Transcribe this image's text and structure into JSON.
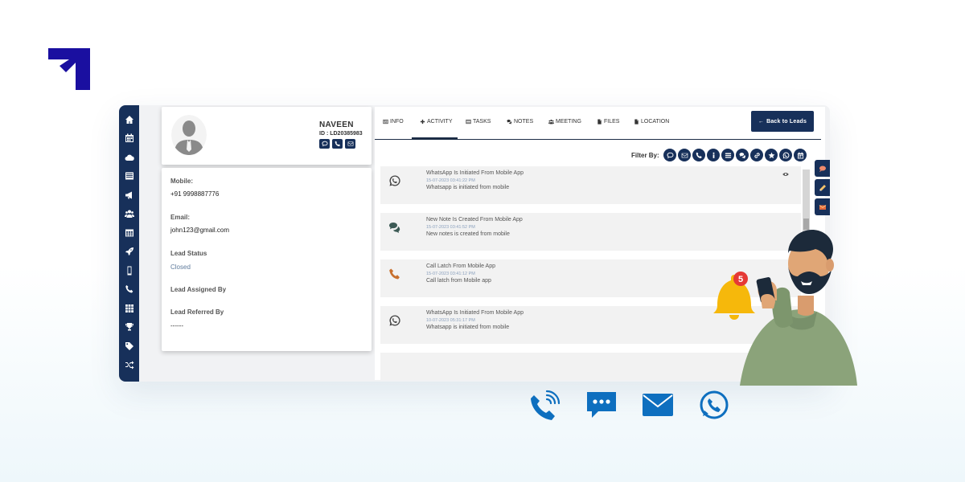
{
  "lead": {
    "name": "NAVEEN",
    "id": "ID : LD20385983"
  },
  "details": [
    {
      "label": "Mobile:",
      "value": "+91 9998887776"
    },
    {
      "label": "Email:",
      "value": "john123@gmail.com"
    },
    {
      "label": "Lead Status",
      "value": "Closed"
    },
    {
      "label": "Lead Assigned By",
      "value": ""
    },
    {
      "label": "Lead Referred By",
      "value": "------"
    }
  ],
  "tabs": [
    {
      "label": "INFO",
      "icon": "info-card-icon"
    },
    {
      "label": "ACTIVITY",
      "icon": "plus-icon"
    },
    {
      "label": "TASKS",
      "icon": "tasks-icon"
    },
    {
      "label": "NOTES",
      "icon": "comments-icon"
    },
    {
      "label": "MEETING",
      "icon": "users-icon"
    },
    {
      "label": "FILES",
      "icon": "file-icon"
    },
    {
      "label": "LOCATION",
      "icon": "file-icon"
    }
  ],
  "active_tab": "ACTIVITY",
  "back_button": "Back to Leads",
  "filter_label": "Filter By:",
  "filter_icons": [
    "chat-icon",
    "email-icon",
    "phone-icon",
    "info-icon",
    "list-icon",
    "comments-icon",
    "link-icon",
    "star-icon",
    "whatsapp-icon",
    "calendar-icon"
  ],
  "activities": [
    {
      "icon": "whatsapp-icon",
      "title": "WhatsApp Is Initiated From Mobile App",
      "time": "15-07-2023 03:41:22 PM",
      "desc": "Whatsapp is initiated from mobile"
    },
    {
      "icon": "comments-icon",
      "title": "New Note Is Created From Mobile App",
      "time": "15-07-2023 03:41:52 PM",
      "desc": "New notes is created from mobile"
    },
    {
      "icon": "phone-icon",
      "title": "Call Latch From Mobile App",
      "time": "15-07-2023 03:41:12 PM",
      "desc": "Call latch from Mobile app"
    },
    {
      "icon": "whatsapp-icon",
      "title": "WhatsApp Is Initiated From Mobile App",
      "time": "10-07-2023 05:31:17 PM",
      "desc": "Whatsapp is initiated from mobile"
    }
  ],
  "notification_count": "5",
  "colors": {
    "navy": "#17305a",
    "brand": "#1a0fa0",
    "accent_blue": "#0e6fbf",
    "bell": "#f6b80b",
    "badge": "#e53935"
  }
}
